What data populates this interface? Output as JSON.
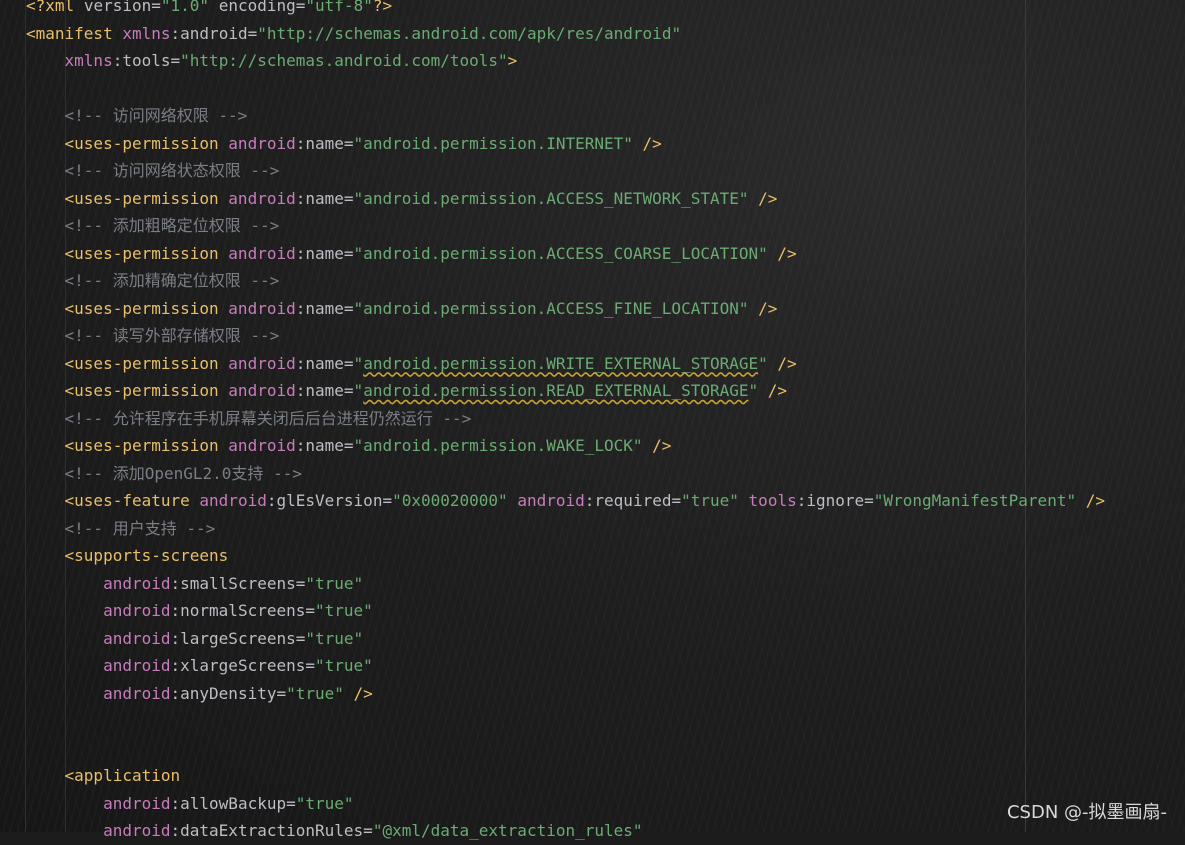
{
  "editor": {
    "lines": [
      "<?xml version=\"1.0\" encoding=\"utf-8\"?>",
      "<manifest xmlns:android=\"http://schemas.android.com/apk/res/android\"",
      "    xmlns:tools=\"http://schemas.android.com/tools\">",
      "",
      "    <!-- 访问网络权限 -->",
      "    <uses-permission android:name=\"android.permission.INTERNET\" />",
      "    <!-- 访问网络状态权限 -->",
      "    <uses-permission android:name=\"android.permission.ACCESS_NETWORK_STATE\" />",
      "    <!-- 添加粗略定位权限 -->",
      "    <uses-permission android:name=\"android.permission.ACCESS_COARSE_LOCATION\" />",
      "    <!-- 添加精确定位权限 -->",
      "    <uses-permission android:name=\"android.permission.ACCESS_FINE_LOCATION\" />",
      "    <!-- 读写外部存储权限 -->",
      "    <uses-permission android:name=\"android.permission.WRITE_EXTERNAL_STORAGE\" />",
      "    <uses-permission android:name=\"android.permission.READ_EXTERNAL_STORAGE\" />",
      "    <!-- 允许程序在手机屏幕关闭后后台进程仍然运行 -->",
      "    <uses-permission android:name=\"android.permission.WAKE_LOCK\" />",
      "    <!-- 添加OpenGL2.0支持 -->",
      "    <uses-feature android:glEsVersion=\"0x00020000\" android:required=\"true\" tools:ignore=\"WrongManifestParent\" />",
      "    <!-- 用户支持 -->",
      "    <supports-screens",
      "        android:smallScreens=\"true\"",
      "        android:normalScreens=\"true\"",
      "        android:largeScreens=\"true\"",
      "        android:xlargeScreens=\"true\"",
      "        android:anyDensity=\"true\" />",
      "",
      "",
      "    <application",
      "        android:allowBackup=\"true\"",
      "        android:dataExtractionRules=\"@xml/data_extraction_rules\""
    ],
    "warning_strings": [
      "android.permission.WRITE_EXTERNAL_STORAGE",
      "android.permission.READ_EXTERNAL_STORAGE"
    ],
    "colors": {
      "background": "#1c1c1c",
      "tag": "#e8bf6a",
      "namespace": "#c77dbb",
      "attribute": "#bcbec4",
      "string": "#6aab73",
      "comment": "#7a7e85",
      "warning_underline": "#c9a231"
    }
  },
  "watermark": {
    "text": "CSDN @-拟墨画扇-"
  }
}
